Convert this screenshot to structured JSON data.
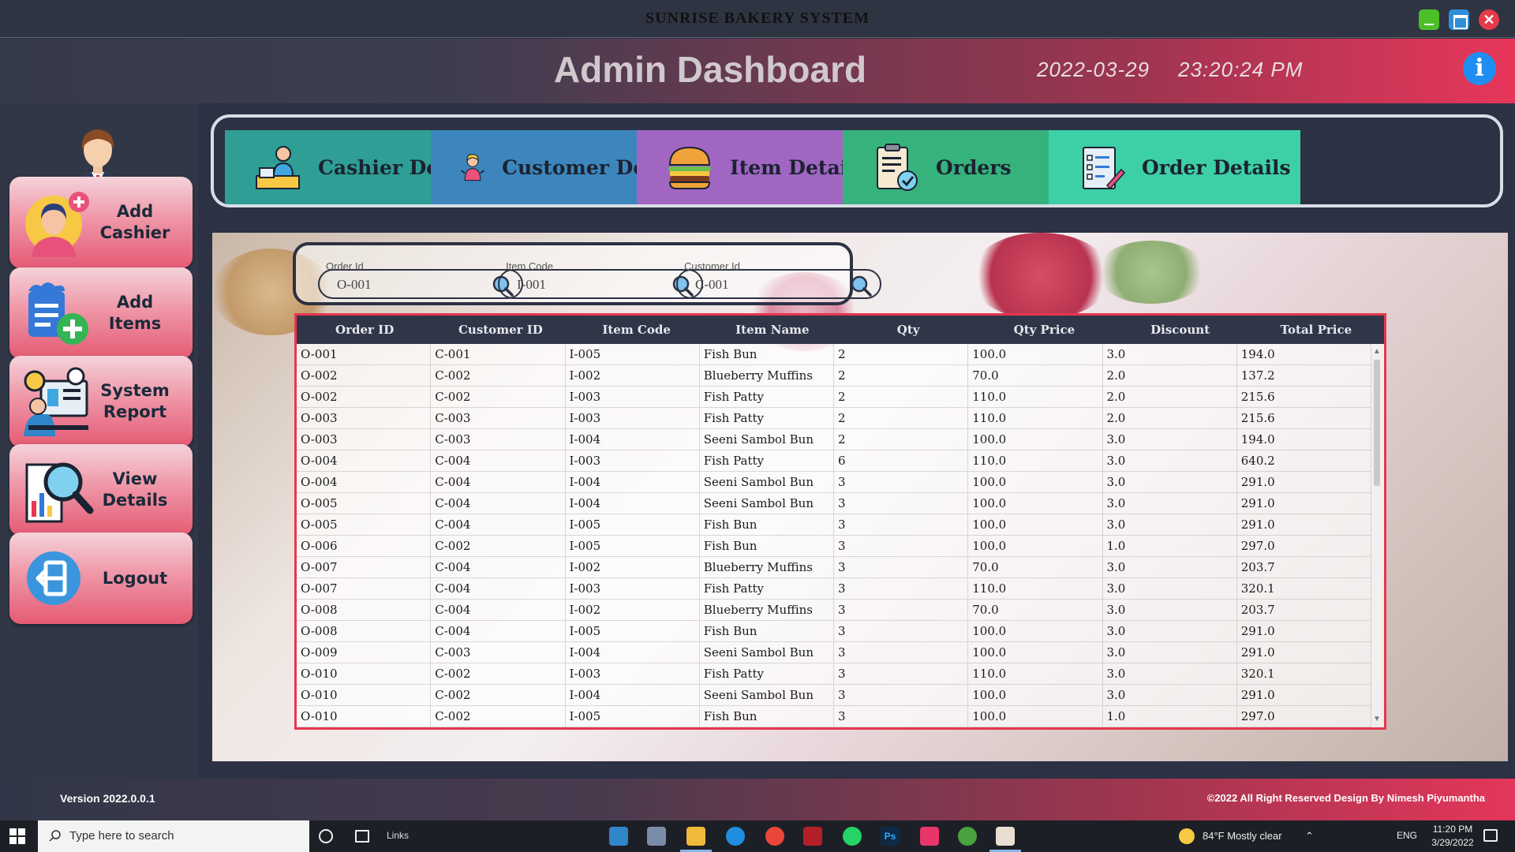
{
  "window": {
    "title": "SUNRISE BAKERY SYSTEM"
  },
  "header": {
    "title": "Admin Dashboard",
    "date": "2022-03-29",
    "time": "23:20:24 PM",
    "info_icon": "info-icon"
  },
  "sidebar": {
    "items": [
      {
        "label": "Add Cashier",
        "icon": "add-cashier-icon"
      },
      {
        "label": "Add Items",
        "icon": "add-items-icon"
      },
      {
        "label": "System Report",
        "icon": "system-report-icon"
      },
      {
        "label": "View Details",
        "icon": "view-details-icon"
      },
      {
        "label": "Logout",
        "icon": "logout-icon"
      }
    ]
  },
  "tabs": [
    {
      "label": "Cashier Detail",
      "color": "#2f9e95",
      "icon": "cashier-icon"
    },
    {
      "label": "Customer Detail",
      "color": "#3d86bd",
      "icon": "customer-icon"
    },
    {
      "label": "Item Detail",
      "color": "#a066c2",
      "icon": "burger-icon"
    },
    {
      "label": "Orders",
      "color": "#36b27d",
      "icon": "clipboard-check-icon"
    },
    {
      "label": "Order Details",
      "color": "#3dcfa6",
      "icon": "checklist-icon"
    }
  ],
  "search": {
    "order_id": {
      "label": "Order Id",
      "value": "O-001"
    },
    "item_code": {
      "label": "Item Code",
      "value": "I-001"
    },
    "customer_id": {
      "label": "Customer Id",
      "value": "C-001"
    }
  },
  "table": {
    "columns": [
      "Order ID",
      "Customer ID",
      "Item Code",
      "Item Name",
      "Qty",
      "Qty Price",
      "Discount",
      "Total Price"
    ],
    "rows": [
      [
        "O-001",
        "C-001",
        "I-005",
        "Fish Bun",
        "2",
        "100.0",
        "3.0",
        "194.0"
      ],
      [
        "O-002",
        "C-002",
        "I-002",
        "Blueberry Muffins",
        "2",
        "70.0",
        "2.0",
        "137.2"
      ],
      [
        "O-002",
        "C-002",
        "I-003",
        "Fish Patty",
        "2",
        "110.0",
        "2.0",
        "215.6"
      ],
      [
        "O-003",
        "C-003",
        "I-003",
        "Fish Patty",
        "2",
        "110.0",
        "2.0",
        "215.6"
      ],
      [
        "O-003",
        "C-003",
        "I-004",
        "Seeni Sambol Bun",
        "2",
        "100.0",
        "3.0",
        "194.0"
      ],
      [
        "O-004",
        "C-004",
        "I-003",
        "Fish Patty",
        "6",
        "110.0",
        "3.0",
        "640.2"
      ],
      [
        "O-004",
        "C-004",
        "I-004",
        "Seeni Sambol Bun",
        "3",
        "100.0",
        "3.0",
        "291.0"
      ],
      [
        "O-005",
        "C-004",
        "I-004",
        "Seeni Sambol Bun",
        "3",
        "100.0",
        "3.0",
        "291.0"
      ],
      [
        "O-005",
        "C-004",
        "I-005",
        "Fish Bun",
        "3",
        "100.0",
        "3.0",
        "291.0"
      ],
      [
        "O-006",
        "C-002",
        "I-005",
        "Fish Bun",
        "3",
        "100.0",
        "1.0",
        "297.0"
      ],
      [
        "O-007",
        "C-004",
        "I-002",
        "Blueberry Muffins",
        "3",
        "70.0",
        "3.0",
        "203.7"
      ],
      [
        "O-007",
        "C-004",
        "I-003",
        "Fish Patty",
        "3",
        "110.0",
        "3.0",
        "320.1"
      ],
      [
        "O-008",
        "C-004",
        "I-002",
        "Blueberry Muffins",
        "3",
        "70.0",
        "3.0",
        "203.7"
      ],
      [
        "O-008",
        "C-004",
        "I-005",
        "Fish Bun",
        "3",
        "100.0",
        "3.0",
        "291.0"
      ],
      [
        "O-009",
        "C-003",
        "I-004",
        "Seeni Sambol Bun",
        "3",
        "100.0",
        "3.0",
        "291.0"
      ],
      [
        "O-010",
        "C-002",
        "I-003",
        "Fish Patty",
        "3",
        "110.0",
        "3.0",
        "320.1"
      ],
      [
        "O-010",
        "C-002",
        "I-004",
        "Seeni Sambol Bun",
        "3",
        "100.0",
        "3.0",
        "291.0"
      ],
      [
        "O-010",
        "C-002",
        "I-005",
        "Fish Bun",
        "3",
        "100.0",
        "1.0",
        "297.0"
      ]
    ]
  },
  "footer": {
    "version": "Version 2022.0.0.1",
    "copyright": "©2022  All Right Reserved Design By Nimesh Piyumantha"
  },
  "taskbar": {
    "search_placeholder": "Type here to search",
    "links": "Links",
    "weather": "84°F  Mostly clear",
    "lang": "ENG",
    "time": "11:20 PM",
    "date": "3/29/2022"
  }
}
